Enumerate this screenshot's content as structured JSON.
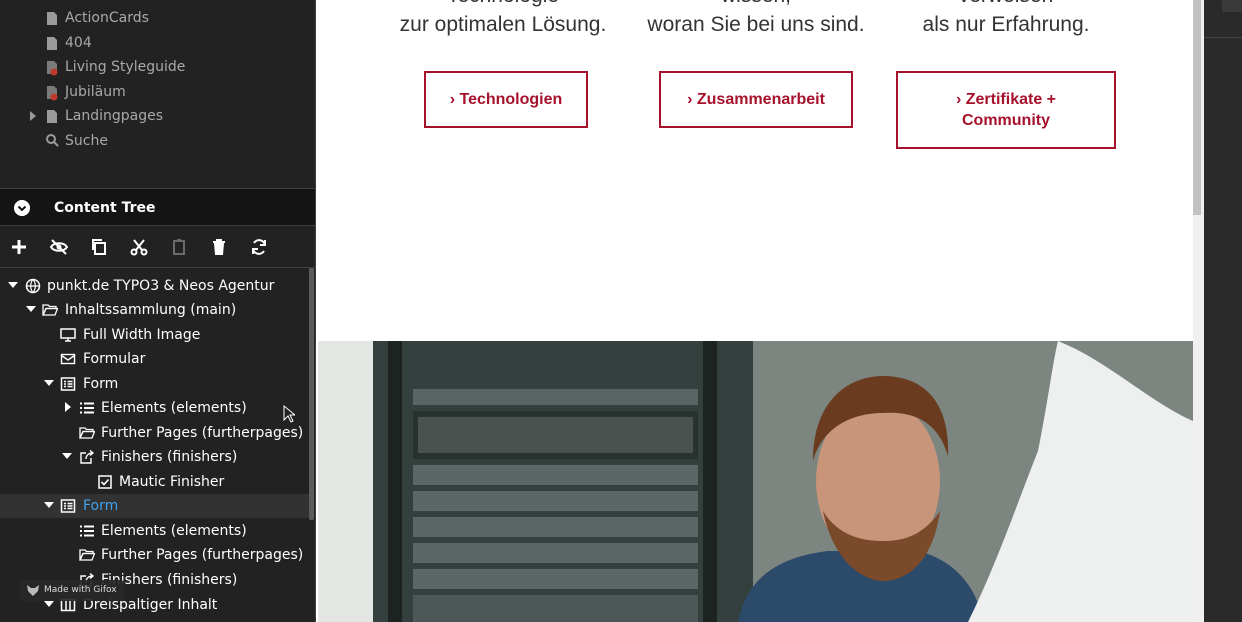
{
  "document_tree": {
    "items": [
      {
        "label": "ActionCards",
        "icon": "file-icon"
      },
      {
        "label": "404",
        "icon": "file-icon"
      },
      {
        "label": "Living Styleguide",
        "icon": "file-hidden-icon"
      },
      {
        "label": "Jubiläum",
        "icon": "file-hidden-icon"
      },
      {
        "label": "Landingpages",
        "icon": "file-icon"
      },
      {
        "label": "Suche",
        "icon": "search-icon"
      }
    ]
  },
  "content_tree": {
    "title": "Content Tree",
    "toolbar": [
      "add",
      "hide",
      "copy",
      "cut",
      "paste",
      "delete",
      "refresh"
    ],
    "nodes": [
      {
        "label": "punkt.de TYPO3 & Neos Agentur",
        "icon": "globe-icon",
        "toggle": "down"
      },
      {
        "label": "Inhaltssammlung (main)",
        "icon": "folder-open-icon",
        "toggle": "down"
      },
      {
        "label": "Full Width Image",
        "icon": "desktop-icon",
        "toggle": ""
      },
      {
        "label": "Formular",
        "icon": "envelope-icon",
        "toggle": ""
      },
      {
        "label": "Form",
        "icon": "list-alt-icon",
        "toggle": "down"
      },
      {
        "label": "Elements (elements)",
        "icon": "list-icon",
        "toggle": "right"
      },
      {
        "label": "Further Pages (furtherpages)",
        "icon": "folder-open-icon",
        "toggle": ""
      },
      {
        "label": "Finishers (finishers)",
        "icon": "share-square-icon",
        "toggle": "down"
      },
      {
        "label": "Mautic Finisher",
        "icon": "check-square-icon",
        "toggle": ""
      },
      {
        "label": "Form",
        "icon": "list-alt-icon",
        "toggle": "down",
        "active": true
      },
      {
        "label": "Elements (elements)",
        "icon": "list-icon",
        "toggle": ""
      },
      {
        "label": "Further Pages (furtherpages)",
        "icon": "folder-open-icon",
        "toggle": ""
      },
      {
        "label": "Finishers (finishers)",
        "icon": "share-square-icon",
        "toggle": ""
      },
      {
        "label": "Dreispaltiger Inhalt",
        "icon": "columns-icon",
        "toggle": "down"
      }
    ]
  },
  "watermark": {
    "text": "Made with Gifox"
  },
  "page": {
    "columns": [
      {
        "cut_line": "Technologie",
        "line2": "zur optimalen Lösung."
      },
      {
        "cut_line": "wissen,",
        "line2": "woran Sie bei uns sind."
      },
      {
        "cut_line": "verweisen",
        "line2": "als nur Erfahrung."
      }
    ],
    "buttons": [
      {
        "label": "› Technologien"
      },
      {
        "label": "› Zusammenarbeit"
      },
      {
        "label": "› Zertifikate + Community"
      }
    ]
  },
  "colors": {
    "brand_red": "#a6122c",
    "active_blue": "#3fa3ee",
    "sidebar_bg": "#222222"
  }
}
